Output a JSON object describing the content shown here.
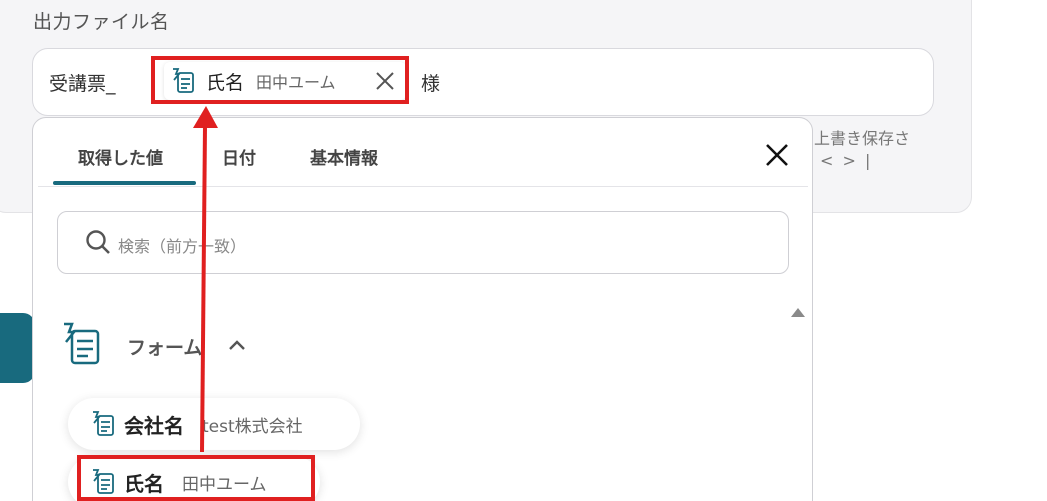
{
  "field": {
    "label": "出力ファイル名",
    "prefix": "受講票_",
    "suffix": "様",
    "chip": {
      "name": "氏名",
      "value": "田中ユーム"
    },
    "hint_line1": "上書き保存さ",
    "hint_line2": "< > |"
  },
  "dropdown": {
    "tabs": [
      {
        "label": "取得した値",
        "active": true
      },
      {
        "label": "日付",
        "active": false
      },
      {
        "label": "基本情報",
        "active": false
      }
    ],
    "search": {
      "placeholder": "検索（前方一致）"
    },
    "group": {
      "label": "フォーム"
    },
    "items": [
      {
        "name": "会社名",
        "value": "test株式会社"
      },
      {
        "name": "氏名",
        "value": "田中ユーム"
      }
    ]
  },
  "colors": {
    "accent": "#186a7e",
    "highlight": "#e02020"
  }
}
